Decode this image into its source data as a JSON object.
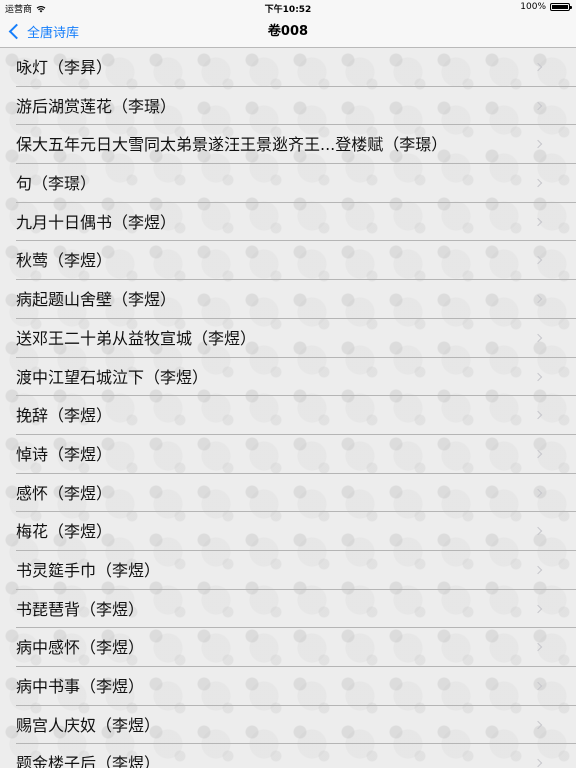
{
  "status_bar": {
    "carrier": "运营商",
    "time": "下午10:52",
    "battery_text": "100%",
    "battery_level": 1.0
  },
  "nav": {
    "back_label": "全唐诗库",
    "title": "卷008"
  },
  "poems": [
    {
      "title": "咏灯（李昪）"
    },
    {
      "title": "游后湖赏莲花（李璟）"
    },
    {
      "title": "保大五年元日大雪同太弟景遂汪王景逖齐王...登楼赋（李璟）"
    },
    {
      "title": "句（李璟）"
    },
    {
      "title": "九月十日偶书（李煜）"
    },
    {
      "title": "秋莺（李煜）"
    },
    {
      "title": "病起题山舍壁（李煜）"
    },
    {
      "title": "送邓王二十弟从益牧宣城（李煜）"
    },
    {
      "title": "渡中江望石城泣下（李煜）"
    },
    {
      "title": "挽辞（李煜）"
    },
    {
      "title": "悼诗（李煜）"
    },
    {
      "title": "感怀（李煜）"
    },
    {
      "title": "梅花（李煜）"
    },
    {
      "title": "书灵筵手巾（李煜）"
    },
    {
      "title": "书琵琶背（李煜）"
    },
    {
      "title": "病中感怀（李煜）"
    },
    {
      "title": "病中书事（李煜）"
    },
    {
      "title": "赐宫人庆奴（李煜）"
    },
    {
      "title": "题金楼子后（李煜）"
    }
  ],
  "colors": {
    "accent": "#157efb",
    "separator": "#b5b5b5",
    "chevron": "#c7c7cc"
  }
}
